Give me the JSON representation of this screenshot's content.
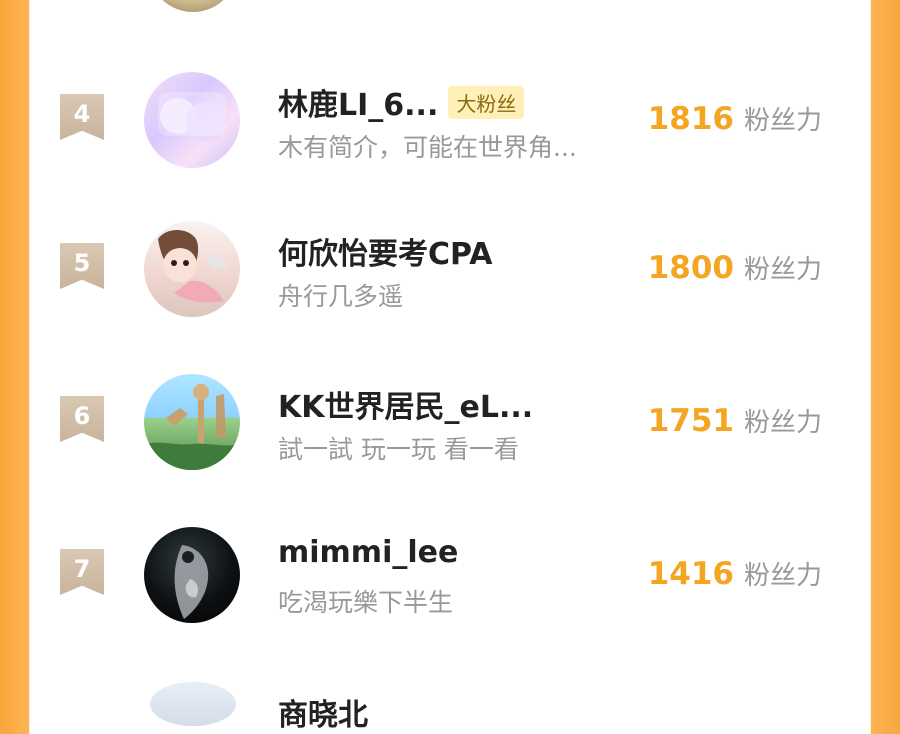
{
  "users": [
    {
      "rank": "4",
      "name": "林鹿LI_6...",
      "badge": "大粉丝",
      "desc": "木有简介，可能在世界角...",
      "score": "1816",
      "score_label": "粉丝力"
    },
    {
      "rank": "5",
      "name": "何欣怡要考CPA",
      "badge": "",
      "desc": "舟行几多遥",
      "score": "1800",
      "score_label": "粉丝力"
    },
    {
      "rank": "6",
      "name": "KK世界居民_eL...",
      "badge": "",
      "desc": "試一試 玩一玩 看一看",
      "score": "1751",
      "score_label": "粉丝力"
    },
    {
      "rank": "7",
      "name": "mimmi_lee",
      "badge": "",
      "desc": "吃渴玩樂下半生",
      "score": "1416",
      "score_label": "粉丝力"
    }
  ],
  "next_user_partial_name": "商晓北"
}
